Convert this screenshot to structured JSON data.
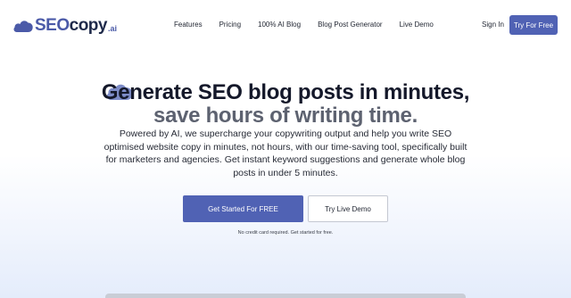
{
  "brand": {
    "name_part1": "SEO",
    "name_part2": "copy",
    "name_suffix": ".ai",
    "logo_icon": "cloud-icon",
    "accent_color": "#5062b4"
  },
  "nav": {
    "links": [
      "Features",
      "Pricing",
      "100% AI Blog",
      "Blog Post Generator",
      "Live Demo"
    ],
    "sign_in": "Sign In",
    "try_for_free": "Try For Free"
  },
  "hero": {
    "title": "Generate SEO blog posts in minutes,",
    "subtitle": "save hours of writing time.",
    "description": "Powered by AI, we supercharge your copywriting output and help you write SEO optimised website copy in minutes, not hours, with our time-saving tool, specifically built for marketers and agencies. Get instant keyword suggestions and generate whole blog posts in under 5 minutes.",
    "primary_cta": "Get Started For FREE",
    "secondary_cta": "Try Live Demo",
    "note": "No credit card required. Get started for free."
  }
}
